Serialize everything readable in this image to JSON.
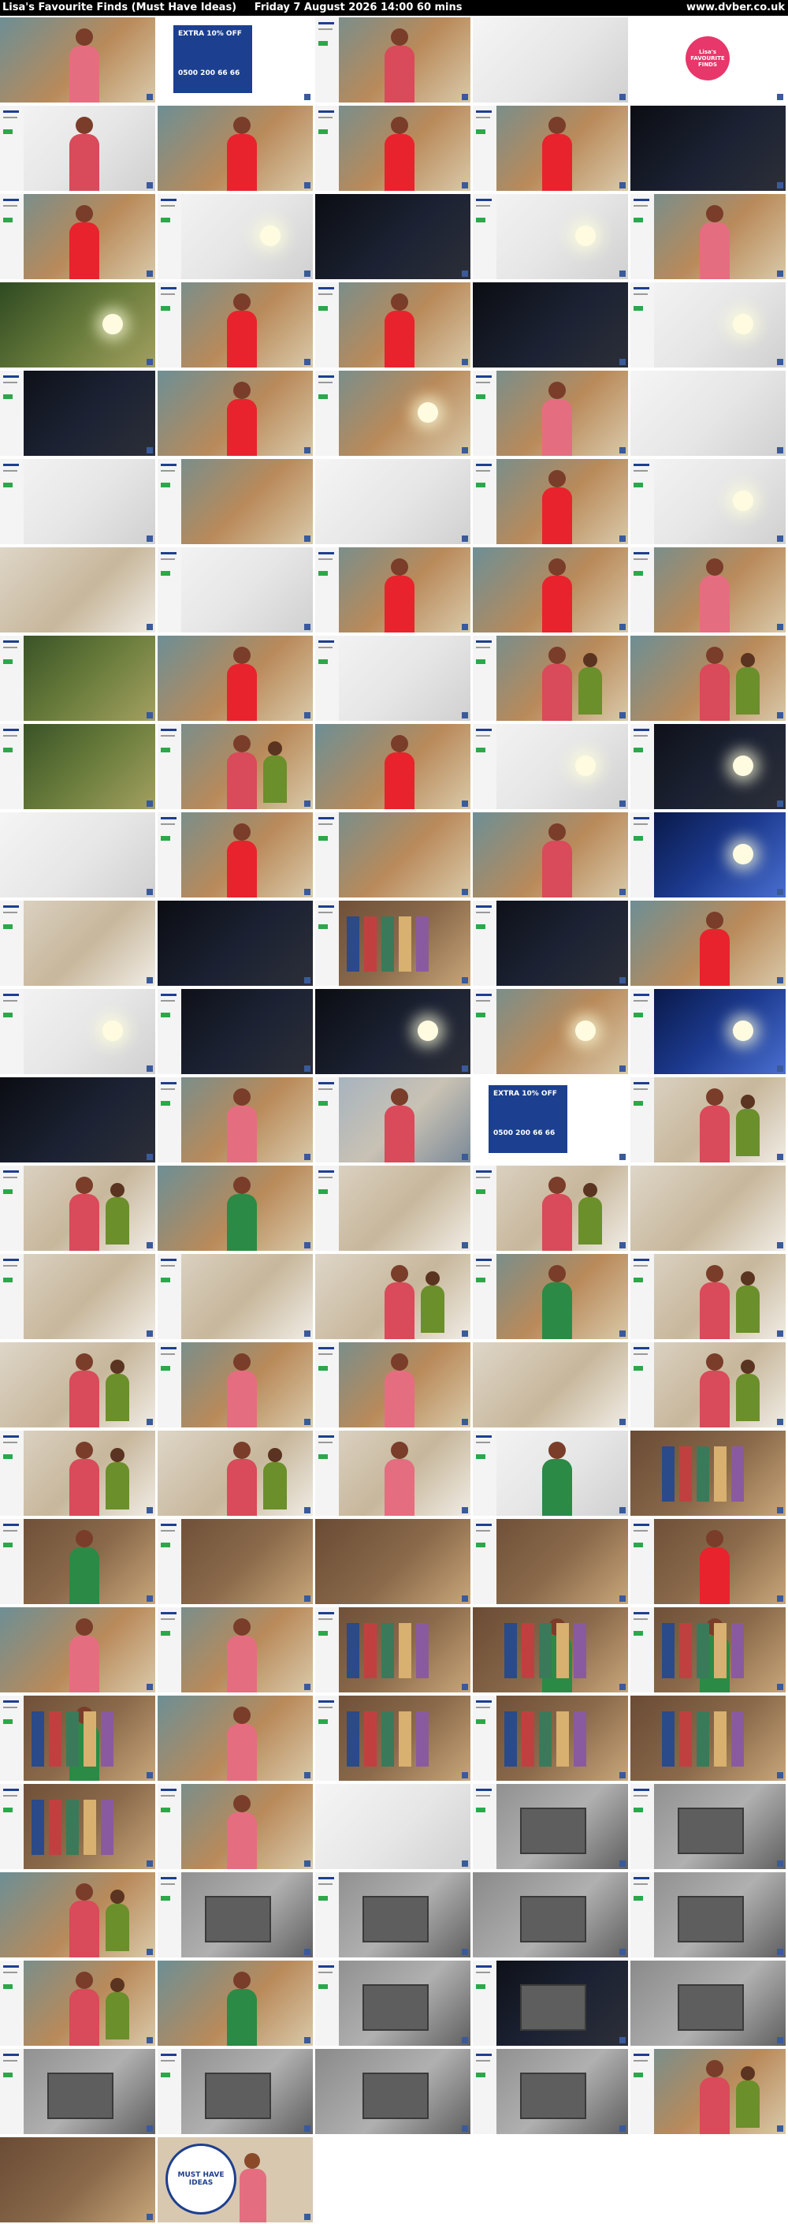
{
  "header": {
    "title": "Lisa's Favourite Finds (Must Have Ideas)",
    "datetime": "Friday 7 August 2026  14:00  60 mins",
    "url": "www.dvber.co.uk"
  },
  "colors": {
    "header_bg": "#000000",
    "header_text": "#ffffff",
    "page_bg": "#ffffff",
    "studio_teal": "#4f7f8c",
    "dress_red": "#e8232d",
    "dress_pink": "#e56d80",
    "dress_green": "#2b8a46",
    "graphic_blue": "#1d3f8f",
    "sidebar_white": "#f4f4f4"
  },
  "grid": {
    "columns": 5,
    "rows": 25
  },
  "promo": {
    "discount_line": "EXTRA 10% OFF",
    "phone": "0500 200 66 66"
  },
  "logo": {
    "line1": "Lisa's",
    "line2": "FAVOURITE",
    "line3": "FINDS"
  },
  "final_logo": {
    "line1": "MUST HAVE",
    "line2": "IDEAS"
  },
  "thumbnails": [
    "presenter-seated",
    "product-promo-graphic",
    "presenter-standing-studio",
    "studio-mirror-product",
    "lisas-favourite-finds-logo",
    "presenter-hand-product",
    "presenter-red-dress",
    "presenter-red-dress",
    "presenter-red-dress-wide",
    "dark-product-demo",
    "presenter-red-dress",
    "solar-light-product",
    "dark-night-garden",
    "solar-light-product",
    "presenter-pink-dress",
    "garden-solar-light",
    "presenter-red-dress",
    "presenter-red-dress",
    "dark-light-demo",
    "light-product-glow",
    "garden-night",
    "presenter-red-dress",
    "solar-light-closeup",
    "presenter-pink-dress",
    "charging-cable-product",
    "product-lilac-cable",
    "wall-socket-demo",
    "hands-product",
    "presenter-red-dress",
    "puck-light-product",
    "kitchen-product",
    "tools-on-desk",
    "presenter-red-dress-desk",
    "presenter-red-dress",
    "presenter-pink-dress",
    "woman-in-garden",
    "presenter-red-dress",
    "hands-demo",
    "studio-wide",
    "studio-wide-two",
    "woman-in-garden",
    "presenter-studio-wide",
    "presenter-red-dress",
    "light-puck-hand",
    "light-glow-dark",
    "hand-product",
    "presenter-red-dress",
    "studio-shelves",
    "presenter-desk-demo",
    "blue-light-glow",
    "fridge-light",
    "dark-room-light",
    "wardrobe-clothes",
    "wardrobe-dark",
    "presenter-trellis",
    "light-puck-product",
    "dark-car-light",
    "blue-light-dark",
    "puck-lights-desk",
    "puck-lights-blue",
    "dark-shed",
    "presenter-pink-dress",
    "beach-presenter",
    "promo-graphic",
    "kitchen-presenters",
    "kitchen-presenters",
    "presenter-green-dress",
    "kitchen-wide",
    "kitchen-presenters",
    "vegetable-product",
    "woman-fridge",
    "cauliflower-product",
    "kitchen-presenters",
    "presenter-green-dress",
    "kitchen-presenters",
    "kitchen-presenters",
    "presenter-pink-dress",
    "presenter-pink-dress",
    "kitchen-woman",
    "kitchen-presenters",
    "kitchen-presenters",
    "kitchen-presenters",
    "presenter-cabbage",
    "green-bag-product",
    "hanger-product",
    "wardrobe-presenter-green",
    "wardrobe-wide",
    "wardrobe-wide",
    "wardrobe-wide",
    "wardrobe-presenter-red",
    "presenter-pink-dress",
    "presenter-pink-dress",
    "blue-clothes-rail",
    "presenter-green-rail",
    "presenter-green-rail",
    "presenter-green-rail",
    "presenter-pink-dress",
    "clothes-rail-hands",
    "blue-clothes-rail",
    "colorful-clothes-rail",
    "clothes-rail-wide",
    "presenter-pink-dress",
    "studio-shelf-product",
    "storage-box-product",
    "storage-box-product",
    "studio-wide-two",
    "storage-box-hands",
    "storage-box-grey",
    "storage-box-stack",
    "storage-box-bed",
    "studio-wide-two",
    "presenter-green-dress",
    "storage-box-open",
    "storage-box-dark",
    "storage-box-stack",
    "storage-box-white",
    "storage-box-grey",
    "storage-box-grey",
    "storage-box-grey",
    "studio-wide-two",
    "wardrobe-closing",
    "must-have-ideas-logo"
  ]
}
